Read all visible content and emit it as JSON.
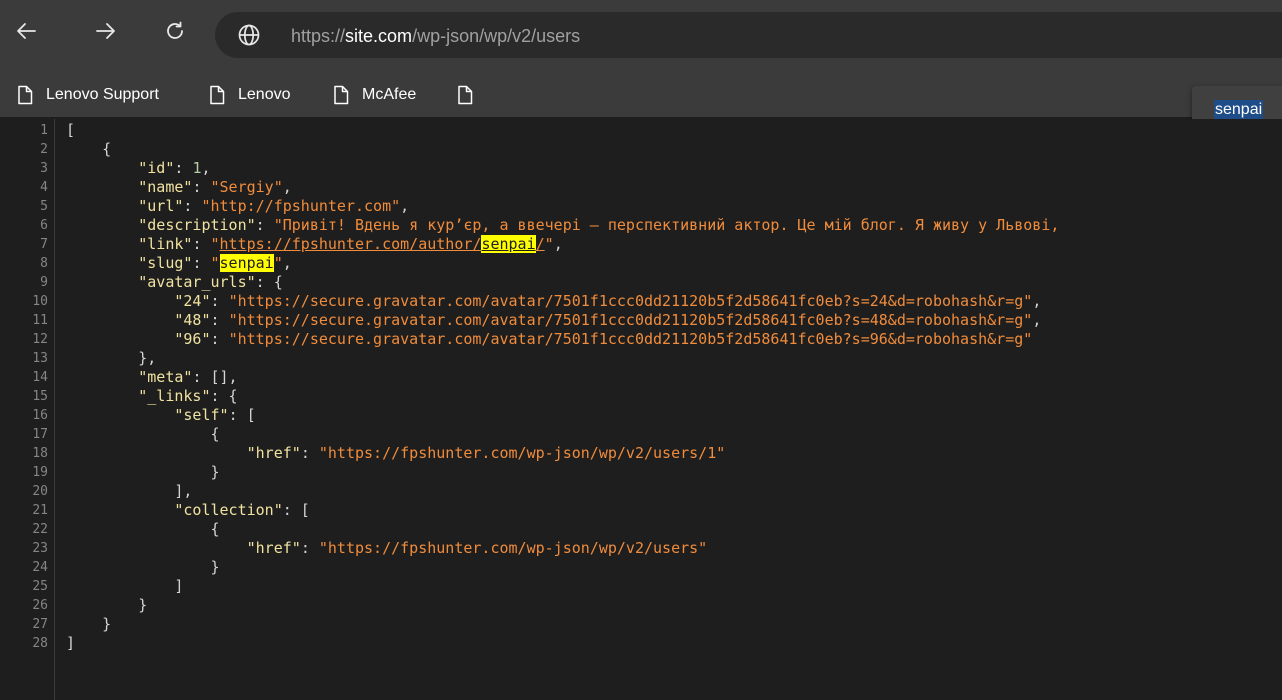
{
  "browser": {
    "url_scheme": "https://",
    "url_host": "site.com",
    "url_path": "/wp-json/wp/v2/users",
    "icons": {
      "back": "arrow-left-icon",
      "forward": "arrow-right-icon",
      "reload": "reload-icon",
      "site_info": "globe-icon",
      "bookmark": "page-icon"
    }
  },
  "bookmarks": [
    {
      "label": "Lenovo Support"
    },
    {
      "label": "Lenovo"
    },
    {
      "label": "McAfee"
    },
    {
      "label": ""
    }
  ],
  "find": {
    "query": "senpai"
  },
  "colors": {
    "background": "#1e1e1e",
    "key": "#f0e2a0",
    "string": "#f08c3c",
    "number": "#b5cea8",
    "highlight": "#ffff00"
  },
  "code": {
    "lines": [
      {
        "n": "1",
        "indent": "",
        "tokens": [
          {
            "t": "[",
            "c": "pun"
          }
        ]
      },
      {
        "n": "2",
        "indent": "    ",
        "tokens": [
          {
            "t": "{",
            "c": "pun"
          }
        ]
      },
      {
        "n": "3",
        "indent": "        ",
        "tokens": [
          {
            "t": "\"id\"",
            "c": "key"
          },
          {
            "t": ": ",
            "c": "pun"
          },
          {
            "t": "1",
            "c": "num"
          },
          {
            "t": ",",
            "c": "pun"
          }
        ]
      },
      {
        "n": "4",
        "indent": "        ",
        "tokens": [
          {
            "t": "\"name\"",
            "c": "key"
          },
          {
            "t": ": ",
            "c": "pun"
          },
          {
            "t": "\"Sergiy\"",
            "c": "str"
          },
          {
            "t": ",",
            "c": "pun"
          }
        ]
      },
      {
        "n": "5",
        "indent": "        ",
        "tokens": [
          {
            "t": "\"url\"",
            "c": "key"
          },
          {
            "t": ": ",
            "c": "pun"
          },
          {
            "t": "\"http://fpshunter.com\"",
            "c": "str"
          },
          {
            "t": ",",
            "c": "pun"
          }
        ]
      },
      {
        "n": "6",
        "indent": "        ",
        "tokens": [
          {
            "t": "\"description\"",
            "c": "key"
          },
          {
            "t": ": ",
            "c": "pun"
          },
          {
            "t": "\"Привіт! Вдень я кур’єр, а ввечері — перспективний актор. Це мій блог. Я живу у Львові,",
            "c": "str"
          }
        ]
      },
      {
        "n": "7",
        "indent": "        ",
        "tokens": [
          {
            "t": "\"link\"",
            "c": "key"
          },
          {
            "t": ": ",
            "c": "pun"
          },
          {
            "t": "\"",
            "c": "str"
          },
          {
            "t": "https://fpshunter.com/author/",
            "c": "str link"
          },
          {
            "t": "senpai",
            "c": "hl link"
          },
          {
            "t": "/",
            "c": "str link"
          },
          {
            "t": "\"",
            "c": "str"
          },
          {
            "t": ",",
            "c": "pun"
          }
        ]
      },
      {
        "n": "8",
        "indent": "        ",
        "tokens": [
          {
            "t": "\"slug\"",
            "c": "key"
          },
          {
            "t": ": ",
            "c": "pun"
          },
          {
            "t": "\"",
            "c": "str"
          },
          {
            "t": "senpai",
            "c": "hl"
          },
          {
            "t": "\"",
            "c": "str"
          },
          {
            "t": ",",
            "c": "pun"
          }
        ]
      },
      {
        "n": "9",
        "indent": "        ",
        "tokens": [
          {
            "t": "\"avatar_urls\"",
            "c": "key"
          },
          {
            "t": ": {",
            "c": "pun"
          }
        ]
      },
      {
        "n": "10",
        "indent": "            ",
        "tokens": [
          {
            "t": "\"24\"",
            "c": "key"
          },
          {
            "t": ": ",
            "c": "pun"
          },
          {
            "t": "\"https://secure.gravatar.com/avatar/7501f1ccc0dd21120b5f2d58641fc0eb?s=24&d=robohash&r=g\"",
            "c": "str"
          },
          {
            "t": ",",
            "c": "pun"
          }
        ]
      },
      {
        "n": "11",
        "indent": "            ",
        "tokens": [
          {
            "t": "\"48\"",
            "c": "key"
          },
          {
            "t": ": ",
            "c": "pun"
          },
          {
            "t": "\"https://secure.gravatar.com/avatar/7501f1ccc0dd21120b5f2d58641fc0eb?s=48&d=robohash&r=g\"",
            "c": "str"
          },
          {
            "t": ",",
            "c": "pun"
          }
        ]
      },
      {
        "n": "12",
        "indent": "            ",
        "tokens": [
          {
            "t": "\"96\"",
            "c": "key"
          },
          {
            "t": ": ",
            "c": "pun"
          },
          {
            "t": "\"https://secure.gravatar.com/avatar/7501f1ccc0dd21120b5f2d58641fc0eb?s=96&d=robohash&r=g\"",
            "c": "str"
          }
        ]
      },
      {
        "n": "13",
        "indent": "        ",
        "tokens": [
          {
            "t": "},",
            "c": "pun"
          }
        ]
      },
      {
        "n": "14",
        "indent": "        ",
        "tokens": [
          {
            "t": "\"meta\"",
            "c": "key"
          },
          {
            "t": ": [],",
            "c": "pun"
          }
        ]
      },
      {
        "n": "15",
        "indent": "        ",
        "tokens": [
          {
            "t": "\"_links\"",
            "c": "key"
          },
          {
            "t": ": {",
            "c": "pun"
          }
        ]
      },
      {
        "n": "16",
        "indent": "            ",
        "tokens": [
          {
            "t": "\"self\"",
            "c": "key"
          },
          {
            "t": ": [",
            "c": "pun"
          }
        ]
      },
      {
        "n": "17",
        "indent": "                ",
        "tokens": [
          {
            "t": "{",
            "c": "pun"
          }
        ]
      },
      {
        "n": "18",
        "indent": "                    ",
        "tokens": [
          {
            "t": "\"href\"",
            "c": "key"
          },
          {
            "t": ": ",
            "c": "pun"
          },
          {
            "t": "\"https://fpshunter.com/wp-json/wp/v2/users/1\"",
            "c": "str"
          }
        ]
      },
      {
        "n": "19",
        "indent": "                ",
        "tokens": [
          {
            "t": "}",
            "c": "pun"
          }
        ]
      },
      {
        "n": "20",
        "indent": "            ",
        "tokens": [
          {
            "t": "],",
            "c": "pun"
          }
        ]
      },
      {
        "n": "21",
        "indent": "            ",
        "tokens": [
          {
            "t": "\"collection\"",
            "c": "key"
          },
          {
            "t": ": [",
            "c": "pun"
          }
        ]
      },
      {
        "n": "22",
        "indent": "                ",
        "tokens": [
          {
            "t": "{",
            "c": "pun"
          }
        ]
      },
      {
        "n": "23",
        "indent": "                    ",
        "tokens": [
          {
            "t": "\"href\"",
            "c": "key"
          },
          {
            "t": ": ",
            "c": "pun"
          },
          {
            "t": "\"https://fpshunter.com/wp-json/wp/v2/users\"",
            "c": "str"
          }
        ]
      },
      {
        "n": "24",
        "indent": "                ",
        "tokens": [
          {
            "t": "}",
            "c": "pun"
          }
        ]
      },
      {
        "n": "25",
        "indent": "            ",
        "tokens": [
          {
            "t": "]",
            "c": "pun"
          }
        ]
      },
      {
        "n": "26",
        "indent": "        ",
        "tokens": [
          {
            "t": "}",
            "c": "pun"
          }
        ]
      },
      {
        "n": "27",
        "indent": "    ",
        "tokens": [
          {
            "t": "}",
            "c": "pun"
          }
        ]
      },
      {
        "n": "28",
        "indent": "",
        "tokens": [
          {
            "t": "]",
            "c": "pun"
          }
        ]
      }
    ]
  }
}
